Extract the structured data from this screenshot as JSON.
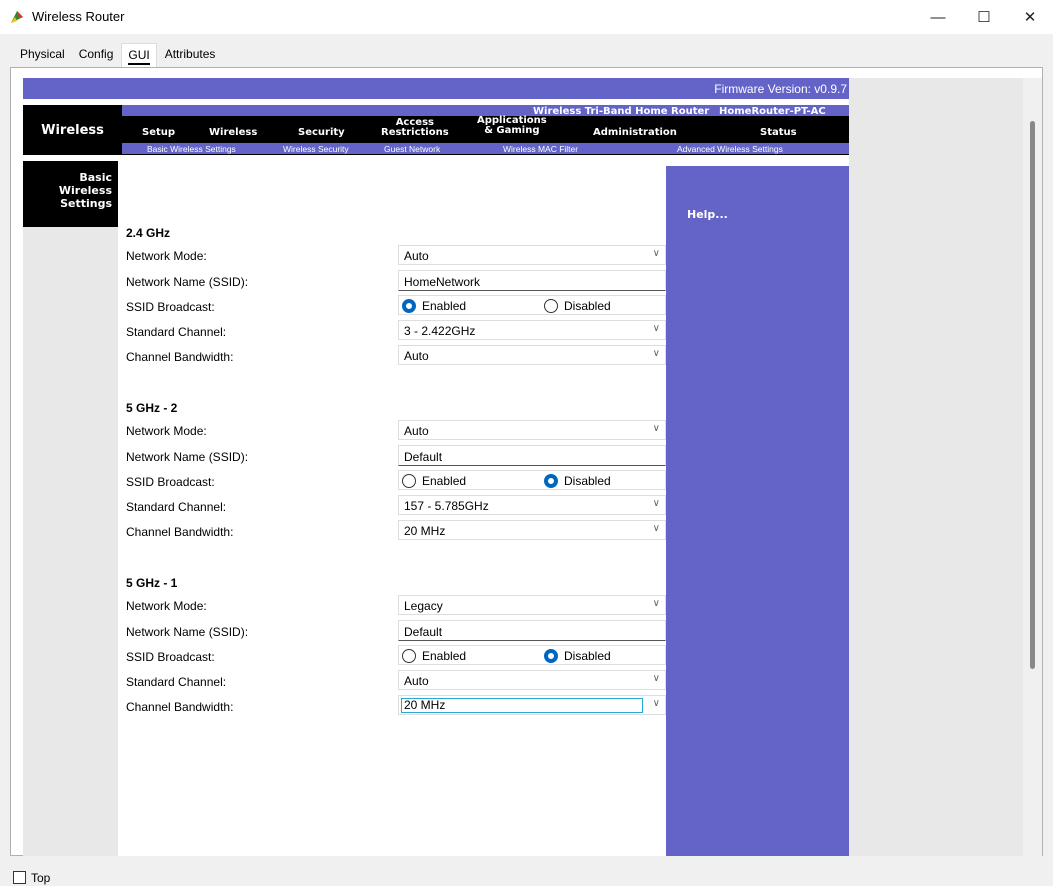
{
  "window": {
    "title": "Wireless Router"
  },
  "tabs": [
    {
      "label": "Physical"
    },
    {
      "label": "Config"
    },
    {
      "label": "GUI"
    },
    {
      "label": "Attributes"
    }
  ],
  "firmware": "Firmware Version: v0.9.7",
  "brand": "Wireless",
  "product_name": "Wireless Tri-Band Home Router",
  "model_name": "HomeRouter-PT-AC",
  "main_nav": [
    {
      "label": "Setup"
    },
    {
      "label": "Wireless"
    },
    {
      "label": "Security"
    },
    {
      "label": "Access\nRestrictions"
    },
    {
      "label": "Applications\n& Gaming"
    },
    {
      "label": "Administration"
    },
    {
      "label": "Status"
    }
  ],
  "sub_nav": [
    {
      "label": "Basic Wireless Settings"
    },
    {
      "label": "Wireless Security"
    },
    {
      "label": "Guest Network"
    },
    {
      "label": "Wireless MAC Filter"
    },
    {
      "label": "Advanced Wireless Settings"
    }
  ],
  "sidebar": {
    "title": "Basic Wireless Settings"
  },
  "help": "Help...",
  "labels": {
    "network_mode": "Network Mode:",
    "ssid": "Network Name (SSID):",
    "broadcast": "SSID Broadcast:",
    "channel": "Standard Channel:",
    "bandwidth": "Channel Bandwidth:",
    "enabled": "Enabled",
    "disabled": "Disabled"
  },
  "bands": [
    {
      "title": "2.4 GHz",
      "mode": "Auto",
      "ssid": "HomeNetwork",
      "broadcast": "Enabled",
      "channel": "3 - 2.422GHz",
      "bandwidth": "Auto"
    },
    {
      "title": "5 GHz - 2",
      "mode": "Auto",
      "ssid": "Default",
      "broadcast": "Disabled",
      "channel": "157 - 5.785GHz",
      "bandwidth": "20 MHz"
    },
    {
      "title": "5 GHz - 1",
      "mode": "Legacy",
      "ssid": "Default",
      "broadcast": "Disabled",
      "channel": "Auto",
      "bandwidth": "20 MHz"
    }
  ],
  "bottom": {
    "top_label": "Top"
  }
}
